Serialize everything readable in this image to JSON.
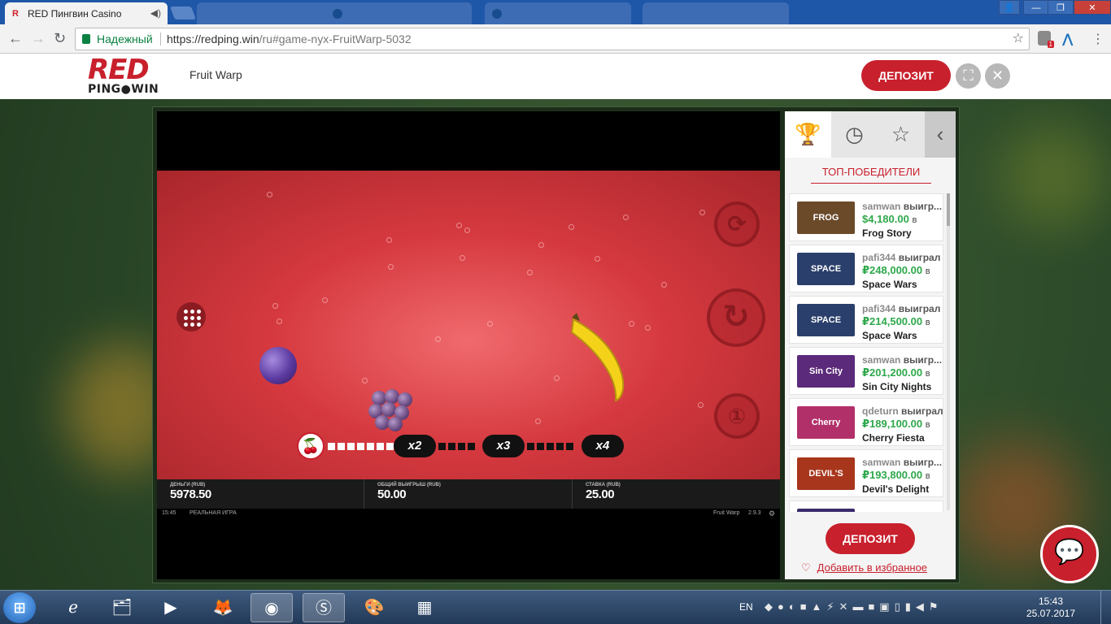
{
  "browser": {
    "active_tab": "RED Пингвин Casino",
    "inactive_tabs": [
      "",
      "",
      "",
      ""
    ],
    "secure_label": "Надежный",
    "url_host": "https://redping.win",
    "url_path": "/ru#game-nyx-FruitWarp-5032",
    "extension_badge": "1"
  },
  "site": {
    "logo_top": "RED",
    "logo_bottom": "PING●WIN",
    "game_title": "Fruit Warp",
    "deposit_label": "ДЕПОЗИТ"
  },
  "game": {
    "multipliers": [
      "x2",
      "x3",
      "x4"
    ],
    "stats": [
      {
        "label": "ДЕНЬГИ (RUB)",
        "value": "5978.50"
      },
      {
        "label": "ОБЩИЙ ВЫИГРЫШ (RUB)",
        "value": "50.00"
      },
      {
        "label": "СТАВКА (RUB)",
        "value": "25.00"
      }
    ],
    "footer_time": "15:45",
    "footer_mode": "РЕАЛЬНАЯ ИГРА",
    "footer_game": "Fruit Warp",
    "footer_version": "2.9.3"
  },
  "panel": {
    "title": "ТОП-ПОБЕДИТЕЛИ",
    "winners": [
      {
        "user": "samwan",
        "verb": "выигр...",
        "amount": "$4,180.00",
        "in": "в",
        "game": "Frog Story",
        "thumb": "FROG STORY",
        "color": "#6b4a2a"
      },
      {
        "user": "pafi344",
        "verb": "выиграл",
        "amount": "₽248,000.00",
        "in": "в",
        "game": "Space Wars",
        "thumb": "SPACE",
        "color": "#2a3f6b"
      },
      {
        "user": "pafi344",
        "verb": "выиграл",
        "amount": "₽214,500.00",
        "in": "в",
        "game": "Space Wars",
        "thumb": "SPACE",
        "color": "#2a3f6b"
      },
      {
        "user": "samwan",
        "verb": "выигр...",
        "amount": "₽201,200.00",
        "in": "в",
        "game": "Sin City Nights",
        "thumb": "Sin City",
        "color": "#5b2a7a"
      },
      {
        "user": "qdeturn",
        "verb": "выиграл",
        "amount": "₽189,100.00",
        "in": "в",
        "game": "Cherry Fiesta",
        "thumb": "Cherry",
        "color": "#b2306a"
      },
      {
        "user": "samwan",
        "verb": "выигр...",
        "amount": "₽193,800.00",
        "in": "в",
        "game": "Devil's Delight",
        "thumb": "DEVIL'S",
        "color": "#a8361c"
      }
    ],
    "deposit_label": "ДЕПОЗИТ",
    "favorite_label": "Добавить в избранное"
  },
  "taskbar": {
    "lang": "EN",
    "time": "15:43",
    "date": "25.07.2017"
  }
}
